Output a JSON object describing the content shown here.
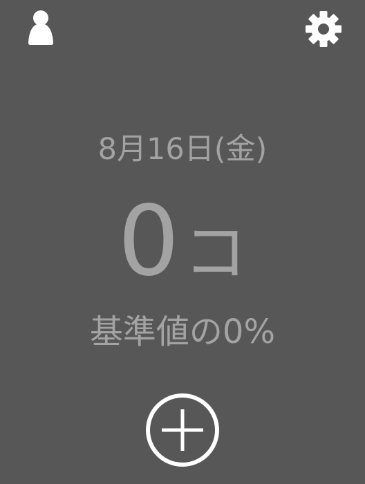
{
  "header": {
    "profile_icon": "person-icon",
    "settings_icon": "gear-icon"
  },
  "main": {
    "date": "8月16日(金)",
    "count_value": "0",
    "count_unit": "コ",
    "ratio_text": "基準値の0%"
  },
  "actions": {
    "add_icon": "plus-circle-icon"
  },
  "colors": {
    "background": "#575757",
    "text": "#a3a3a3",
    "icons": "#ffffff"
  }
}
